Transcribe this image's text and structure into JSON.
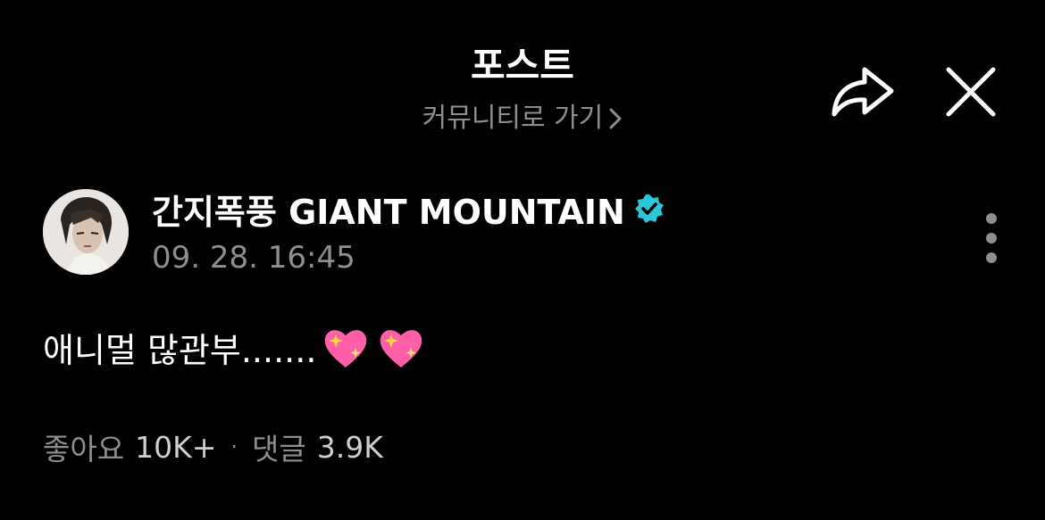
{
  "header": {
    "title": "포스트",
    "community_link": "커뮤니티로 가기",
    "share_icon": "share-arrow-icon",
    "close_icon": "close-icon"
  },
  "post": {
    "author": {
      "name": "간지폭풍 GIANT MOUNTAIN",
      "verified_badge": "verified-badge-icon",
      "avatar": "avatar"
    },
    "time": "09. 28. 16:45",
    "body_text": "애니멀 많관부.......",
    "emojis": [
      "sparkling-heart-emoji",
      "sparkling-heart-emoji"
    ]
  },
  "stats": {
    "likes_label": "좋아요",
    "likes_value": "10K+",
    "separator": "·",
    "comments_label": "댓글",
    "comments_value": "3.9K"
  },
  "colors": {
    "background": "#000000",
    "text_primary": "#ffffff",
    "text_secondary": "#8e8e8e",
    "verified": "#2bc7d6",
    "heart": "#ff5fa8",
    "sparkle": "#ffd23f"
  }
}
